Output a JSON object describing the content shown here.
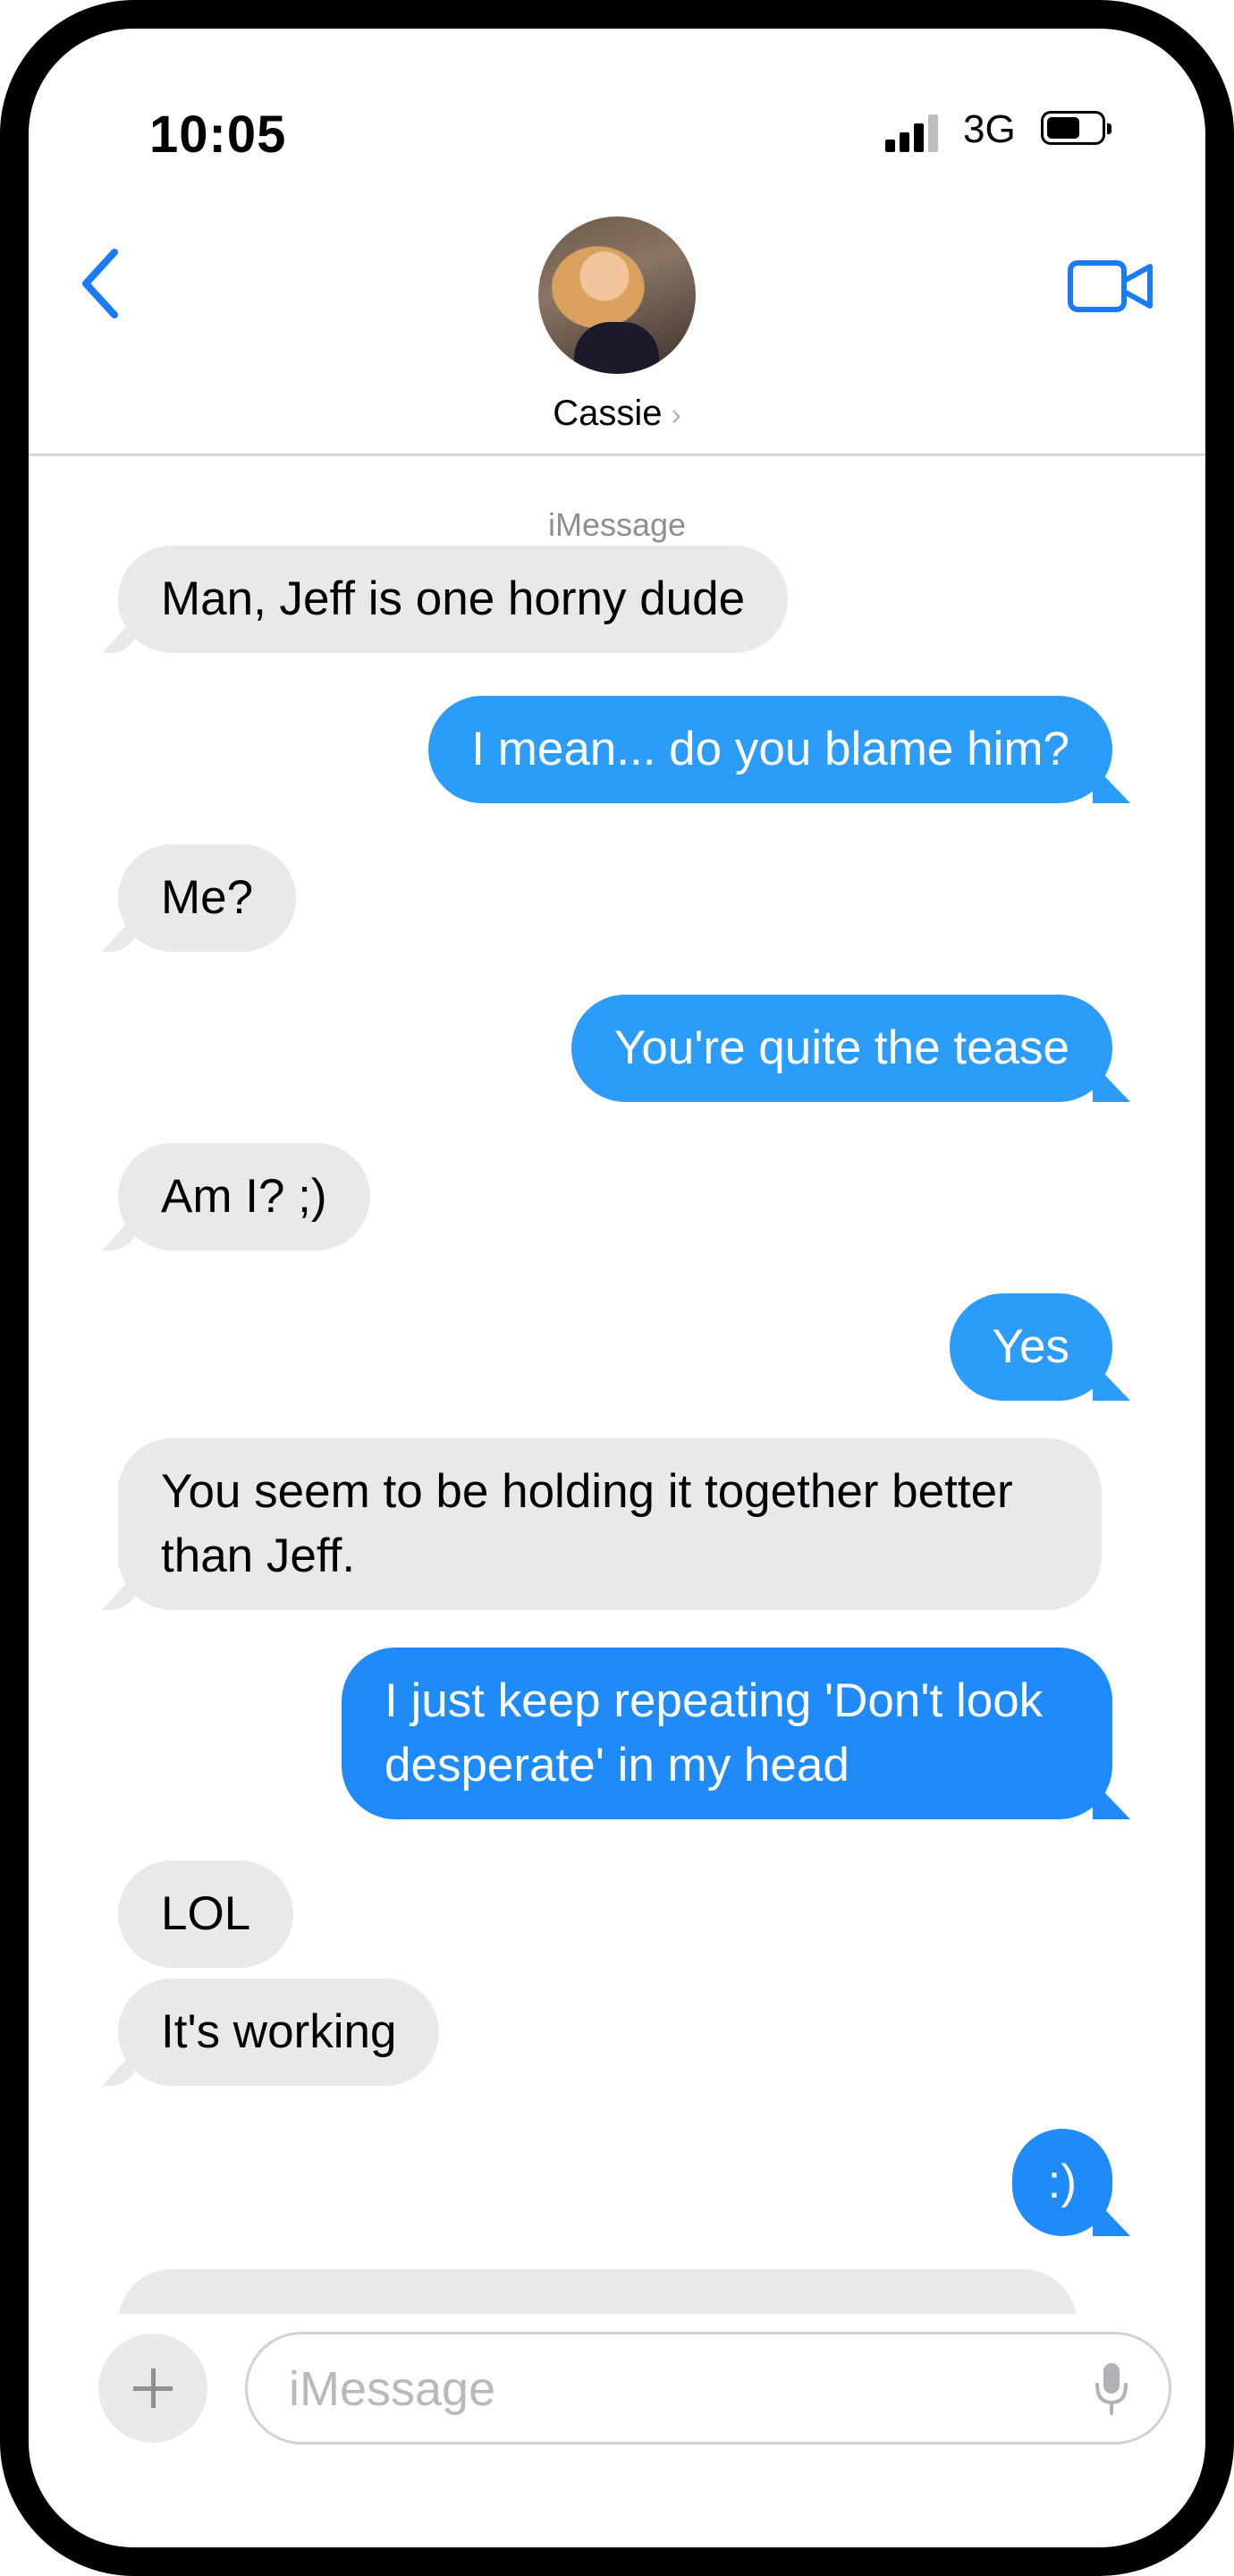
{
  "status_bar": {
    "time": "10:05",
    "network": "3G",
    "signal_bars": 3,
    "signal_bars_max": 4,
    "battery_level": 0.55
  },
  "header": {
    "back_icon": "chevron-left-icon",
    "contact_name": "Cassie",
    "contact_chevron": "›",
    "video_icon": "video-camera-icon",
    "accent_color": "#1a7cf5"
  },
  "thread": {
    "service_label": "iMessage",
    "messages": [
      {
        "direction": "incoming",
        "text": "Man, Jeff is one horny dude"
      },
      {
        "direction": "outgoing",
        "text": "I mean... do you blame him?"
      },
      {
        "direction": "incoming",
        "text": "Me?"
      },
      {
        "direction": "outgoing",
        "text": "You're quite the tease"
      },
      {
        "direction": "incoming",
        "text": "Am I? ;)"
      },
      {
        "direction": "outgoing",
        "text": "Yes"
      },
      {
        "direction": "incoming",
        "lines": [
          "You seem to be holding it together better",
          "than Jeff."
        ]
      },
      {
        "direction": "outgoing",
        "lines": [
          "I just keep repeating 'Don't look",
          "desperate' in my head"
        ]
      },
      {
        "direction": "incoming",
        "text": "LOL"
      },
      {
        "direction": "incoming",
        "text": "It's working"
      },
      {
        "direction": "outgoing",
        "text": ":)"
      }
    ],
    "incoming_color": "#e9e9eb",
    "outgoing_color": "#2c9cf9"
  },
  "input_bar": {
    "plus_icon": "plus-icon",
    "placeholder": "iMessage",
    "value": "",
    "mic_icon": "microphone-icon"
  }
}
